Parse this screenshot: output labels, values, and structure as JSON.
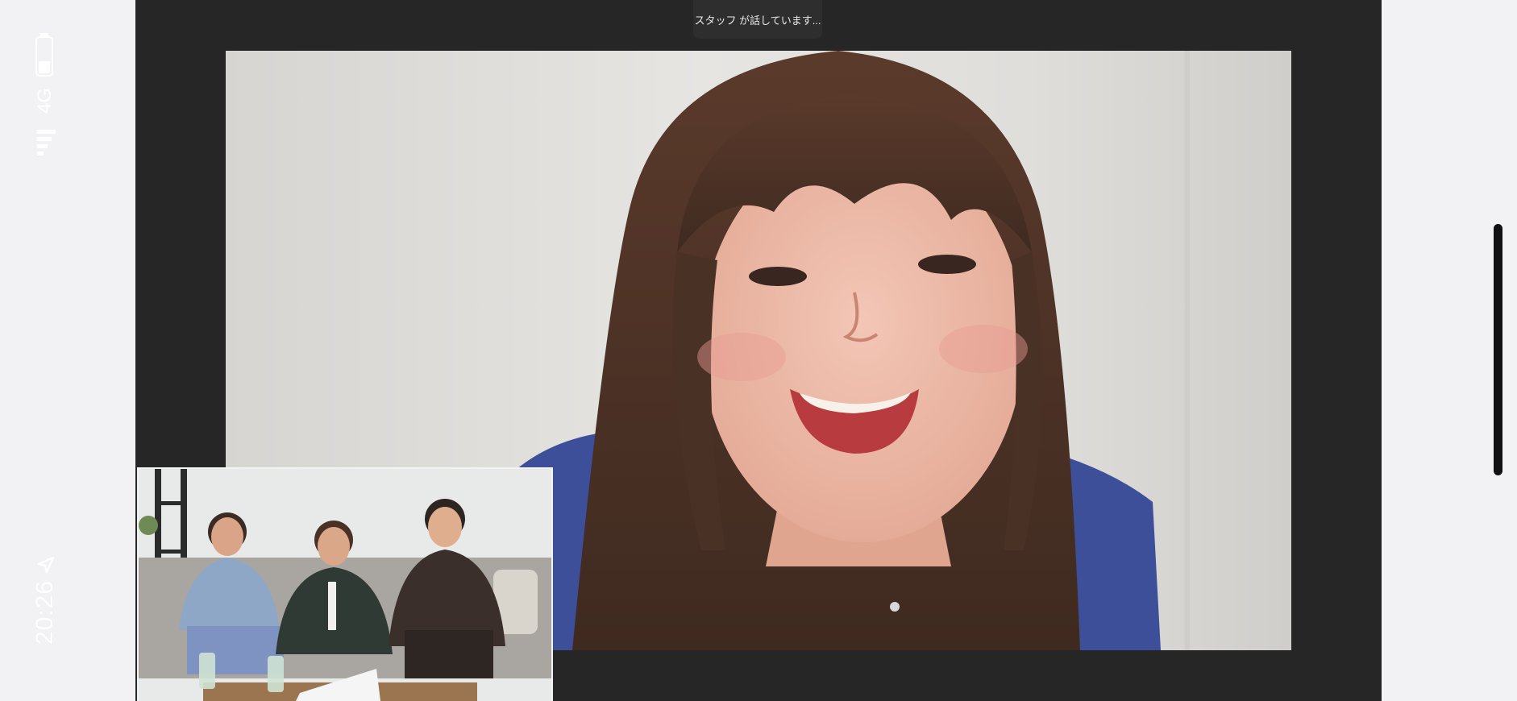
{
  "status_bar": {
    "time": "20:26",
    "network": "4G",
    "icons": [
      "location-arrow-icon",
      "signal-bars-icon",
      "battery-icon"
    ]
  },
  "call": {
    "speaking_indicator": "スタッフ が話しています..."
  },
  "colors": {
    "stage_background": "#262626",
    "indicator_background": "#2e2e2e",
    "page_background": "#f2f2f4",
    "scroll_handle": "#111111"
  }
}
